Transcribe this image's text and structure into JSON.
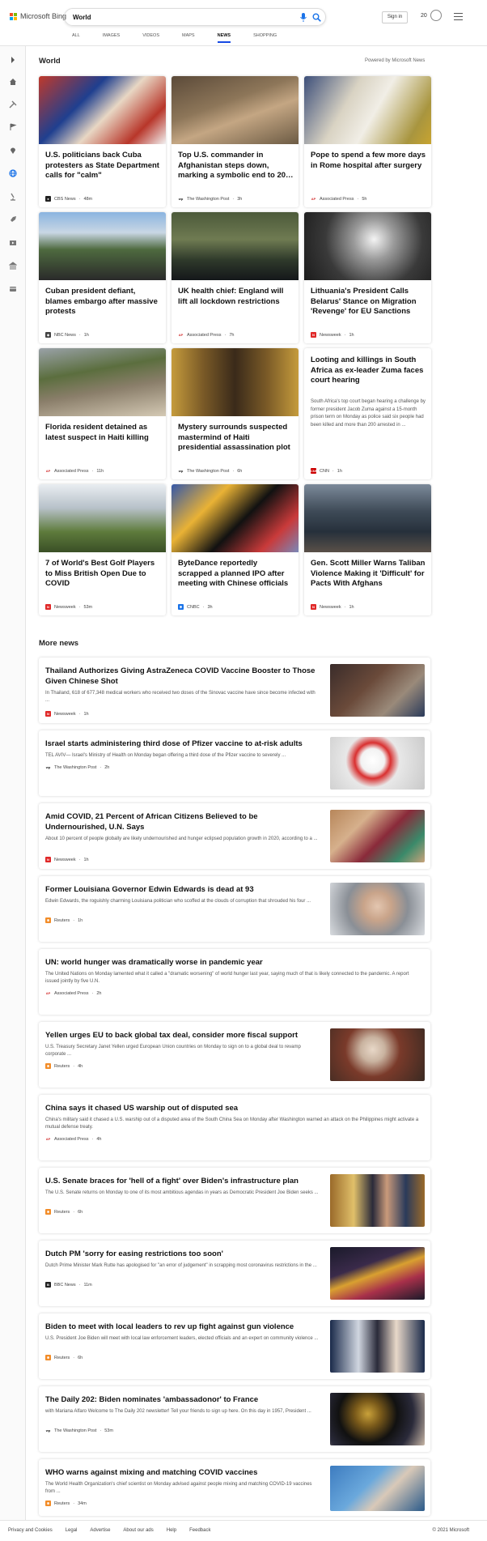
{
  "header": {
    "brand": "Microsoft Bing",
    "search_value": "World",
    "signin_label": "Sign in",
    "points": "20",
    "tabs": [
      {
        "label": "ALL",
        "active": false
      },
      {
        "label": "IMAGES",
        "active": false
      },
      {
        "label": "VIDEOS",
        "active": false
      },
      {
        "label": "MAPS",
        "active": false
      },
      {
        "label": "NEWS",
        "active": true
      },
      {
        "label": "SHOPPING",
        "active": false
      }
    ]
  },
  "rail": {
    "icons": [
      "chevron-right-icon",
      "home-icon",
      "tools-icon",
      "flag-icon",
      "location-icon",
      "globe-icon",
      "microscope-icon",
      "rocket-icon",
      "film-icon",
      "bank-icon",
      "card-icon"
    ]
  },
  "world": {
    "title": "World",
    "powered_by": "Powered by Microsoft News",
    "cards": [
      {
        "title": "U.S. politicians back Cuba protesters as State Department calls for \"calm\"",
        "source": "CBS News",
        "time": "48m",
        "source_color": "#222222"
      },
      {
        "title": "Top U.S. commander in Afghanistan steps down, marking a symbolic end to 20…",
        "source": "The Washington Post",
        "time": "3h",
        "source_color": "#333333"
      },
      {
        "title": "Pope to spend a few more days in Rome hospital after surgery",
        "source": "Associated Press",
        "time": "5h",
        "source_color": "#d32f2f"
      },
      {
        "title": "Cuban president defiant, blames embargo after massive protests",
        "source": "NBC News",
        "time": "1h",
        "source_color": "#444444"
      },
      {
        "title": "UK health chief: England will lift all lockdown restrictions",
        "source": "Associated Press",
        "time": "7h",
        "source_color": "#d32f2f"
      },
      {
        "title": "Lithuania's President Calls Belarus' Stance on Migration 'Revenge' for EU Sanctions",
        "source": "Newsweek",
        "time": "1h",
        "source_color": "#e02828"
      },
      {
        "title": "Florida resident detained as latest suspect in Haiti killing",
        "source": "Associated Press",
        "time": "11h",
        "source_color": "#d32f2f"
      },
      {
        "title": "Mystery surrounds suspected mastermind of Haiti presidential assassination plot",
        "source": "The Washington Post",
        "time": "6h",
        "source_color": "#333333"
      },
      {
        "title": "Looting and killings in South Africa as ex-leader Zuma faces court hearing",
        "snippet": "South Africa's top court began hearing a challenge by former president Jacob Zuma against a 15-month prison term on Monday as police said six people had been killed and more than 200 arrested in ...",
        "source": "CNN",
        "time": "1h",
        "source_color": "#cc0000"
      },
      {
        "title": "7 of World's Best Golf Players to Miss British Open Due to COVID",
        "source": "Newsweek",
        "time": "53m",
        "source_color": "#e02828"
      },
      {
        "title": "ByteDance reportedly scrapped a planned IPO after meeting with Chinese officials",
        "source": "CNBC",
        "time": "3h",
        "source_color": "#1a73e8"
      },
      {
        "title": "Gen. Scott Miller Warns Taliban Violence Making it 'Difficult' for Pacts With Afghans",
        "source": "Newsweek",
        "time": "1h",
        "source_color": "#e02828"
      }
    ]
  },
  "more_news": {
    "title": "More news",
    "items": [
      {
        "title": "Thailand Authorizes Giving AstraZeneca COVID Vaccine Booster to Those Given Chinese Shot",
        "snippet": "In Thailand, 618 of 677,348 medical workers who received two doses of the Sinovac vaccine have since become infected with ...",
        "source": "Newsweek",
        "time": "1h"
      },
      {
        "title": "Israel starts administering third dose of Pfizer vaccine to at-risk adults",
        "snippet": "TEL AVIV— Israel's Ministry of Health on Monday began offering a third dose of the Pfizer vaccine to severely ...",
        "source": "The Washington Post",
        "time": "2h"
      },
      {
        "title": "Amid COVID, 21 Percent of African Citizens Believed to be Undernourished, U.N. Says",
        "snippet": "About 10 percent of people globally are likely undernourished and hunger eclipsed population growth in 2020, according to a ...",
        "source": "Newsweek",
        "time": "1h"
      },
      {
        "title": "Former Louisiana Governor Edwin Edwards is dead at 93",
        "snippet": "Edwin Edwards, the roguishly charming Louisiana politician who scoffed at the clouds of corruption that shrouded his four ...",
        "source": "Reuters",
        "time": "1h"
      },
      {
        "title": "UN: world hunger was dramatically worse in pandemic year",
        "snippet": "The United Nations on Monday lamented what it called a \"dramatic worsening\" of world hunger last year, saying much of that is likely connected to the pandemic. A report issued jointly by five U.N.",
        "source": "Associated Press",
        "time": "2h"
      },
      {
        "title": "Yellen urges EU to back global tax deal, consider more fiscal support",
        "snippet": "U.S. Treasury Secretary Janet Yellen urged European Union countries on Monday to sign on to a global deal to revamp corporate ...",
        "source": "Reuters",
        "time": "4h"
      },
      {
        "title": "China says it chased US warship out of disputed sea",
        "snippet": "China's military said it chased a U.S. warship out of a disputed area of the South China Sea on Monday after Washington warned an attack on the Philippines might activate a mutual defense treaty.",
        "source": "Associated Press",
        "time": "4h"
      },
      {
        "title": "U.S. Senate braces for 'hell of a fight' over Biden's infrastructure plan",
        "snippet": "The U.S. Senate returns on Monday to one of its most ambitious agendas in years as Democratic President Joe Biden seeks ...",
        "source": "Reuters",
        "time": "6h"
      },
      {
        "title": "Dutch PM 'sorry for easing restrictions too soon'",
        "snippet": "Dutch Prime Minister Mark Rutte has apologised for \"an error of judgement\" in scrapping most coronavirus restrictions in the ...",
        "source": "BBC News",
        "time": "11m"
      },
      {
        "title": "Biden to meet with local leaders to rev up fight against gun violence",
        "snippet": "U.S. President Joe Biden will meet with local law enforcement leaders, elected officials and an expert on community violence ...",
        "source": "Reuters",
        "time": "6h"
      },
      {
        "title": "The Daily 202: Biden nominates 'ambassadonor' to France",
        "snippet": "with Mariana Alfaro Welcome to The Daily 202 newsletter! Tell your friends to sign up here. On this day in 1957, President ...",
        "source": "The Washington Post",
        "time": "53m"
      },
      {
        "title": "WHO warns against mixing and matching COVID vaccines",
        "snippet": "The World Health Organization's chief scientist on Monday advised against people mixing and matching COVID-19 vaccines from ...",
        "source": "Reuters",
        "time": "34m"
      }
    ]
  },
  "footer": {
    "links": [
      "Privacy and Cookies",
      "Legal",
      "Advertise",
      "About our ads",
      "Help",
      "Feedback"
    ],
    "copyright": "© 2021 Microsoft"
  }
}
